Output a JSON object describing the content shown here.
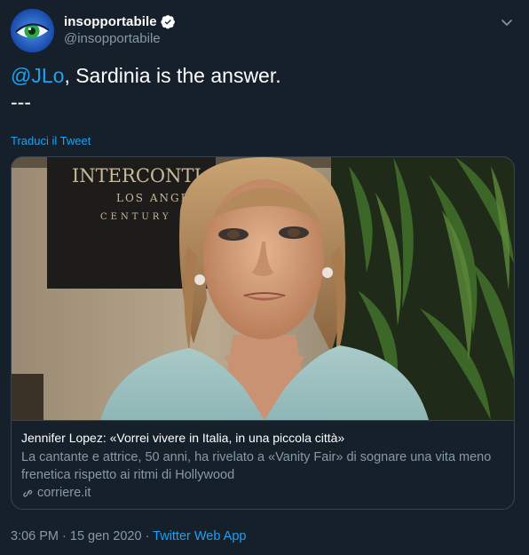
{
  "user": {
    "display_name": "insopportabile",
    "handle": "@insopportabile"
  },
  "tweet": {
    "mention": "@JLo",
    "text_rest": ", Sardinia is the answer.",
    "text_line2": "---",
    "translate_label": "Traduci il Tweet"
  },
  "card": {
    "title": "Jennifer Lopez: «Vorrei vivere in Italia, in una piccola città»",
    "description": "La cantante e attrice, 50 anni, ha rivelato a «Vanity Fair» di sognare una vita meno frenetica rispetto ai ritmi di Hollywood",
    "domain": "corriere.it",
    "image_sign_lines": [
      "INTERCONTI",
      "LOS ANGE",
      "CENTURY"
    ]
  },
  "footer": {
    "time": "3:06 PM",
    "separator": " · ",
    "date": "15 gen 2020",
    "separator2": " · ",
    "app": "Twitter Web App"
  },
  "colors": {
    "background": "#15202b",
    "accent": "#1da1f2",
    "secondary_text": "#8899a6",
    "border": "#38444d"
  },
  "icons": [
    "verified-badge-icon",
    "chevron-down-icon",
    "link-icon"
  ]
}
